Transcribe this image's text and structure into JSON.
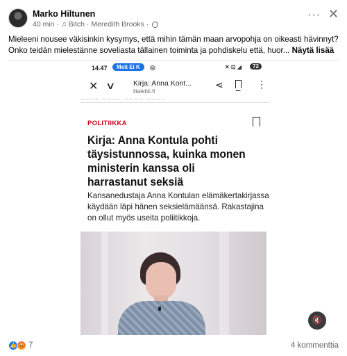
{
  "post": {
    "author": "Marko Hiltunen",
    "time": "40 min",
    "music_icon": "music-note-icon",
    "song": "Bitch",
    "dot": "·",
    "artist": "Meredith Brooks",
    "dot2": "·",
    "privacy_icon": "globe-icon",
    "more_label": "···",
    "close_label": "✕",
    "text": "Mieleeni nousee väkisinkin kysymys, että mihin tämän maan arvopohja on oikeasti hävinnyt? Onko teidän mielestänne soveliasta tällainen toiminta ja pohdiskelu että, huor...",
    "see_more": "Näytä lisää"
  },
  "phone": {
    "time": "14.47",
    "pill": "Meit Ei K",
    "status_icons": "✕ ⊡ ◢",
    "battery": "72"
  },
  "browser": {
    "close_label": "✕",
    "chevron_label": "∨",
    "page_title": "Kirja: Anna Kont...",
    "page_url": "iltalehti.fi",
    "share_label": "⋖",
    "kebab_label": "⋮",
    "cut_strip": "──── ──── ──── ────"
  },
  "article": {
    "category": "POLITIIKKA",
    "title": "Kirja: Anna Kontula pohti täysistunnossa, kuinka monen ministerin kanssa oli harrastanut seksiä",
    "lead": "Kansanedustaja Anna Kontulan elämäkertakirjassa käydään läpi hänen seksielämäänsä. Rakastajina on ollut myös useita poliitikkoja."
  },
  "video": {
    "mute_label": "🔇"
  },
  "footer": {
    "like_icon": "👍",
    "angry_icon": "😡",
    "reaction_count": "7",
    "comments": "4 kommenttia"
  },
  "colors": {
    "accent_red": "#d0021b",
    "like_blue": "#1877f2",
    "meta_gray": "#65676b"
  }
}
